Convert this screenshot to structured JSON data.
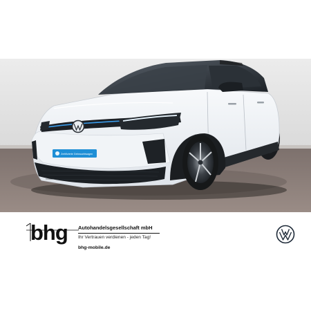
{
  "photo": {
    "subject": "car-photo",
    "license_plate": "Zertifizierte Gebrauchtwagen"
  },
  "dealer": {
    "logo_text": "bhg",
    "company": "Autohandelsgesellschaft mbH",
    "slogan": "Ihr Vertrauen verdienen - jeden Tag!",
    "website": "bhg-mobile.de"
  },
  "brand": {
    "icon": "vw-logo-icon"
  },
  "colors": {
    "car_body": "#eef1f5",
    "roof": "#1d2126",
    "light_bar": "#3ea9ff",
    "plate": "#1f8fd6",
    "floor": "#8a7b76"
  }
}
